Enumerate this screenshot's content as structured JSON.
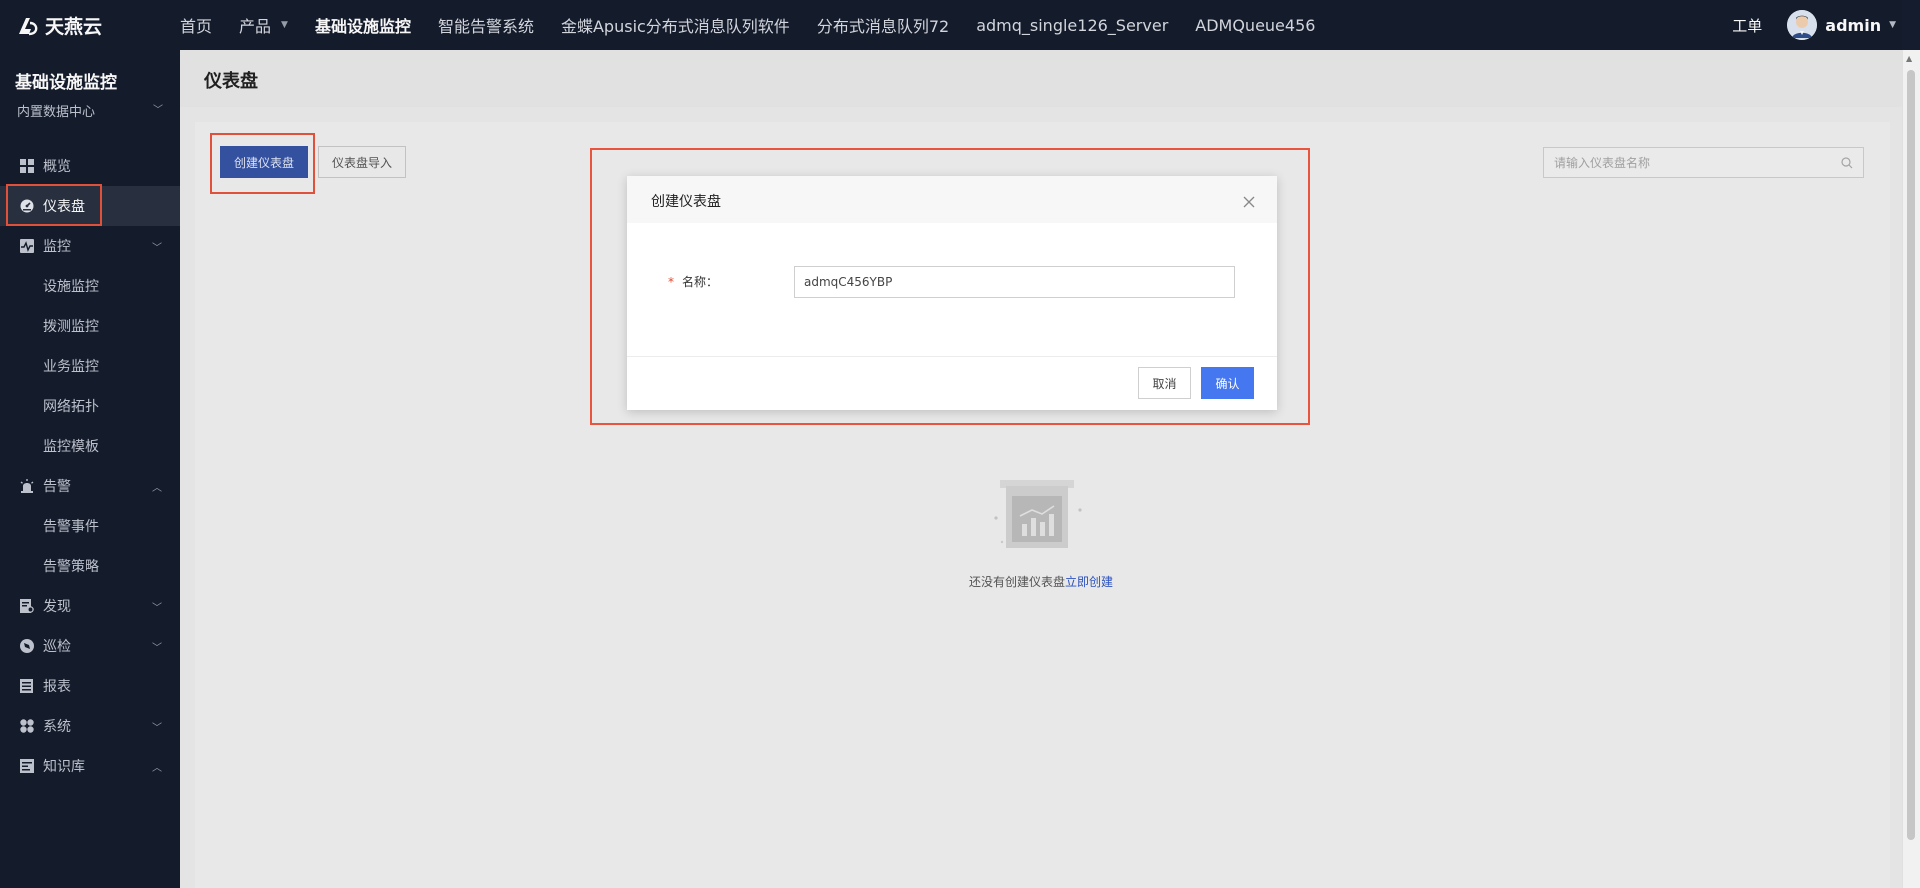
{
  "brand": {
    "name": "天燕云"
  },
  "topnav": {
    "items": [
      {
        "label": "首页"
      },
      {
        "label": "产品"
      },
      {
        "label": "基础设施监控"
      },
      {
        "label": "智能告警系统"
      },
      {
        "label": "金蝶Apusic分布式消息队列软件"
      },
      {
        "label": "分布式消息队列72"
      },
      {
        "label": "admq_single126_Server"
      },
      {
        "label": "ADMQueue456"
      }
    ],
    "ticket": "工单",
    "user": "admin"
  },
  "sidebar": {
    "title": "基础设施监控",
    "datacenter": "内置数据中心",
    "items": [
      {
        "label": "概览",
        "icon": "grid-icon"
      },
      {
        "label": "仪表盘",
        "icon": "dashboard-icon"
      },
      {
        "label": "监控",
        "icon": "monitor-icon"
      },
      {
        "label": "设施监控"
      },
      {
        "label": "拨测监控"
      },
      {
        "label": "业务监控"
      },
      {
        "label": "网络拓扑"
      },
      {
        "label": "监控模板"
      },
      {
        "label": "告警",
        "icon": "alarm-icon"
      },
      {
        "label": "告警事件"
      },
      {
        "label": "告警策略"
      },
      {
        "label": "发现",
        "icon": "discover-icon"
      },
      {
        "label": "巡检",
        "icon": "inspect-icon"
      },
      {
        "label": "报表",
        "icon": "report-icon"
      },
      {
        "label": "系统",
        "icon": "system-icon"
      },
      {
        "label": "知识库",
        "icon": "knowledge-icon"
      }
    ]
  },
  "page": {
    "title": "仪表盘",
    "create_button": "创建仪表盘",
    "import_button": "仪表盘导入",
    "search_placeholder": "请输入仪表盘名称",
    "empty_text": "还没有创建仪表盘",
    "empty_link": "立即创建"
  },
  "modal": {
    "title": "创建仪表盘",
    "required_mark": "*",
    "name_label": "名称：",
    "name_value": "admqC456YBP",
    "cancel": "取消",
    "confirm": "确认"
  },
  "colors": {
    "nav_bg": "#151c2d",
    "primary": "#4578f0",
    "highlight": "#e8543e"
  }
}
